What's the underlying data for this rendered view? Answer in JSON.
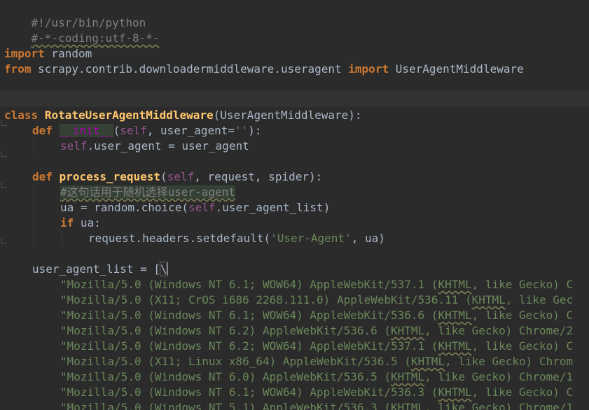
{
  "editor": {
    "language": "python",
    "colors": {
      "background": "#2b2b2b",
      "text": "#a9b7c6",
      "keyword": "#cc7832",
      "function": "#ffc66d",
      "self": "#94558d",
      "string": "#6a8759",
      "comment": "#808080"
    },
    "lines": {
      "l1": {
        "text": "#!/usr/bin/python"
      },
      "l2": {
        "text": "#-*-coding:utf-8-*-"
      },
      "l4": {
        "kw": "import",
        "rest": " random"
      },
      "l5": {
        "kw1": "from",
        "module": " scrapy.contrib.downloadermiddleware.useragent ",
        "kw2": "import",
        "name": " UserAgentMiddleware"
      },
      "l7": {
        "kw": "class",
        "space": " ",
        "name": "RotateUserAgentMiddleware",
        "base": "(UserAgentMiddleware):"
      },
      "l8": {
        "kw": "def",
        "space": " ",
        "name": "__init__",
        "p1": "(",
        "self": "self",
        "rest": ", user_agent=",
        "str": "''",
        "end": "):"
      },
      "l9": {
        "self": "self",
        "rest": ".user_agent = user_agent"
      },
      "l11": {
        "kw": "def",
        "space": " ",
        "name": "process_request",
        "p1": "(",
        "self": "self",
        "rest": ", request, spider):"
      },
      "l12": {
        "comment": "#这句话用于随机选择user-agent"
      },
      "l13": {
        "pre": "ua = random.choice(",
        "self": "self",
        "rest": ".user_agent_list)"
      },
      "l14": {
        "kw": "if",
        "rest": " ua:"
      },
      "l15": {
        "pre": "request.headers.setdefault(",
        "str": "'User-Agent'",
        "rest": ", ua)"
      },
      "l17": {
        "pre": "user_agent_list = [",
        "bs": "\\"
      },
      "ua1": {
        "a": "\"Mozilla/5.0 (Windows NT 6.1; WOW64) AppleWebKit/537.1 (",
        "w": "KHTML",
        "b": ", like Gecko) C"
      },
      "ua2": {
        "a": "\"Mozilla/5.0 (X11; CrOS i686 2268.111.0) AppleWebKit/536.11 (",
        "w": "KHTML",
        "b": ", like Gec"
      },
      "ua3": {
        "a": "\"Mozilla/5.0 (Windows NT 6.1; WOW64) AppleWebKit/536.6 (",
        "w": "KHTML",
        "b": ", like Gecko) C"
      },
      "ua4": {
        "a": "\"Mozilla/5.0 (Windows NT 6.2) AppleWebKit/536.6 (",
        "w": "KHTML",
        "b": ", like Gecko) Chrome/2"
      },
      "ua5": {
        "a": "\"Mozilla/5.0 (Windows NT 6.2; WOW64) AppleWebKit/537.1 (",
        "w": "KHTML",
        "b": ", like Gecko) C"
      },
      "ua6": {
        "a": "\"Mozilla/5.0 (X11; Linux x86_64) AppleWebKit/536.5 (",
        "w": "KHTML",
        "b": ", like Gecko) Chrom"
      },
      "ua7": {
        "a": "\"Mozilla/5.0 (Windows NT 6.0) AppleWebKit/536.5 (",
        "w": "KHTML",
        "b": ", like Gecko) Chrome/1"
      },
      "ua8": {
        "a": "\"Mozilla/5.0 (Windows NT 6.1; WOW64) AppleWebKit/536.3 (",
        "w": "KHTML",
        "b": ", like Gecko) C"
      },
      "ua9": {
        "a": "\"Mozilla/5.0 (Windows NT 5.1) AppleWebKit/536.3 (",
        "w": "KHTML",
        "b": ", like Gecko) Chrome/1"
      }
    }
  }
}
